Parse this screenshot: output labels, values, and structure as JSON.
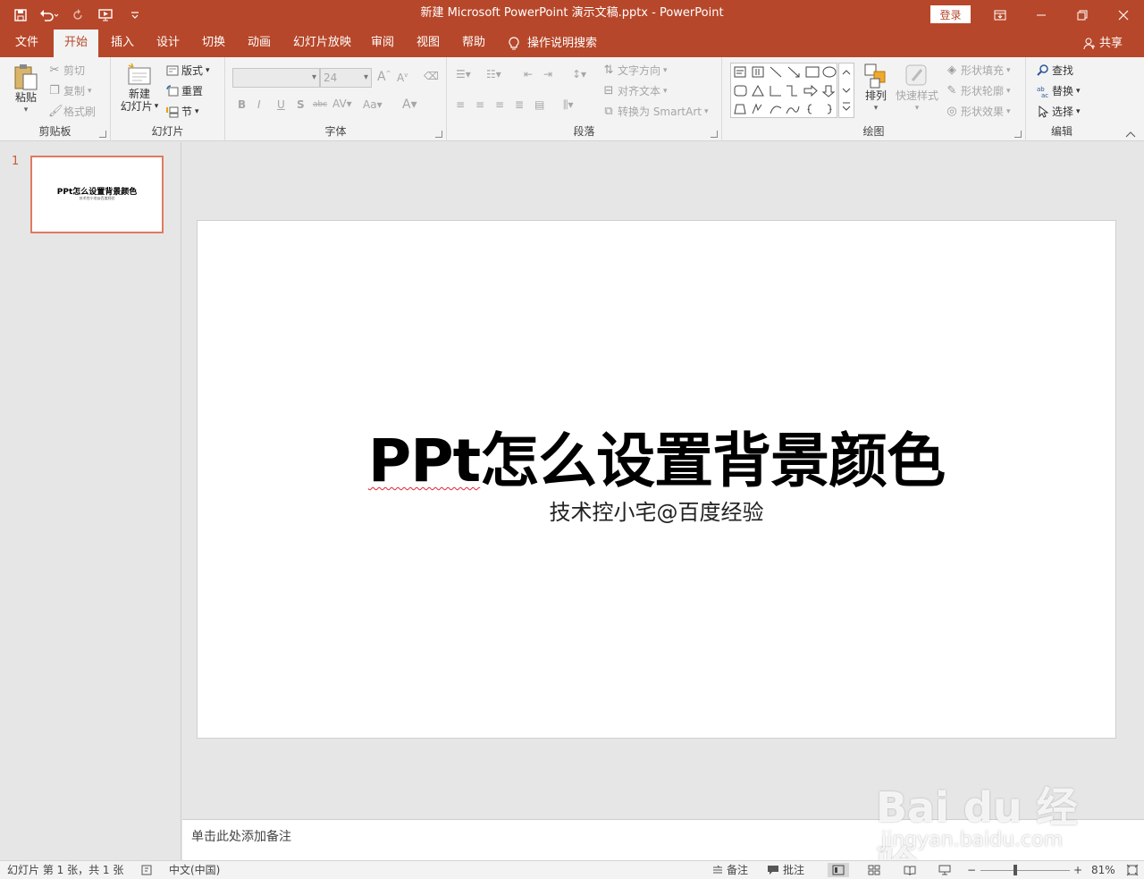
{
  "window": {
    "title": "新建 Microsoft PowerPoint 演示文稿.pptx  -  PowerPoint",
    "login_label": "登录",
    "accent": "#b7472a"
  },
  "tabs": [
    {
      "label": "文件"
    },
    {
      "label": "开始"
    },
    {
      "label": "插入"
    },
    {
      "label": "设计"
    },
    {
      "label": "切换"
    },
    {
      "label": "动画"
    },
    {
      "label": "幻灯片放映"
    },
    {
      "label": "审阅"
    },
    {
      "label": "视图"
    },
    {
      "label": "帮助"
    }
  ],
  "tellme": "操作说明搜索",
  "share": "共享",
  "ribbon": {
    "clipboard": {
      "label": "剪贴板",
      "paste": "粘贴",
      "cut": "剪切",
      "copy": "复制",
      "format_painter": "格式刷"
    },
    "slides": {
      "label": "幻灯片",
      "new_slide_1": "新建",
      "new_slide_2": "幻灯片",
      "layout": "版式",
      "reset": "重置",
      "section": "节"
    },
    "font": {
      "label": "字体",
      "font_size": "24"
    },
    "paragraph": {
      "label": "段落",
      "text_direction": "文字方向",
      "align_text": "对齐文本",
      "smartart": "转换为 SmartArt"
    },
    "drawing": {
      "label": "绘图",
      "arrange": "排列",
      "quick_styles": "快速样式",
      "shape_fill": "形状填充",
      "shape_outline": "形状轮廓",
      "shape_effects": "形状效果"
    },
    "editing": {
      "label": "编辑",
      "find": "查找",
      "replace": "替换",
      "select": "选择"
    }
  },
  "thumbnails": [
    {
      "number": "1",
      "title": "PPt怎么设置背景颜色",
      "subtitle": "技术控小宅@百度经验"
    }
  ],
  "slide": {
    "title_spell": "PPt",
    "title_rest": "怎么设置背景颜色",
    "subtitle": "技术控小宅@百度经验"
  },
  "notes_placeholder": "单击此处添加备注",
  "status": {
    "slide_info": "幻灯片 第 1 张，共 1 张",
    "language": "中文(中国)",
    "notes": "备注",
    "comments": "批注",
    "zoom": "81%",
    "zoom_level": 0.81
  },
  "watermark": {
    "logo": "Bai du 经验",
    "url": "jingyan.baidu.com"
  }
}
